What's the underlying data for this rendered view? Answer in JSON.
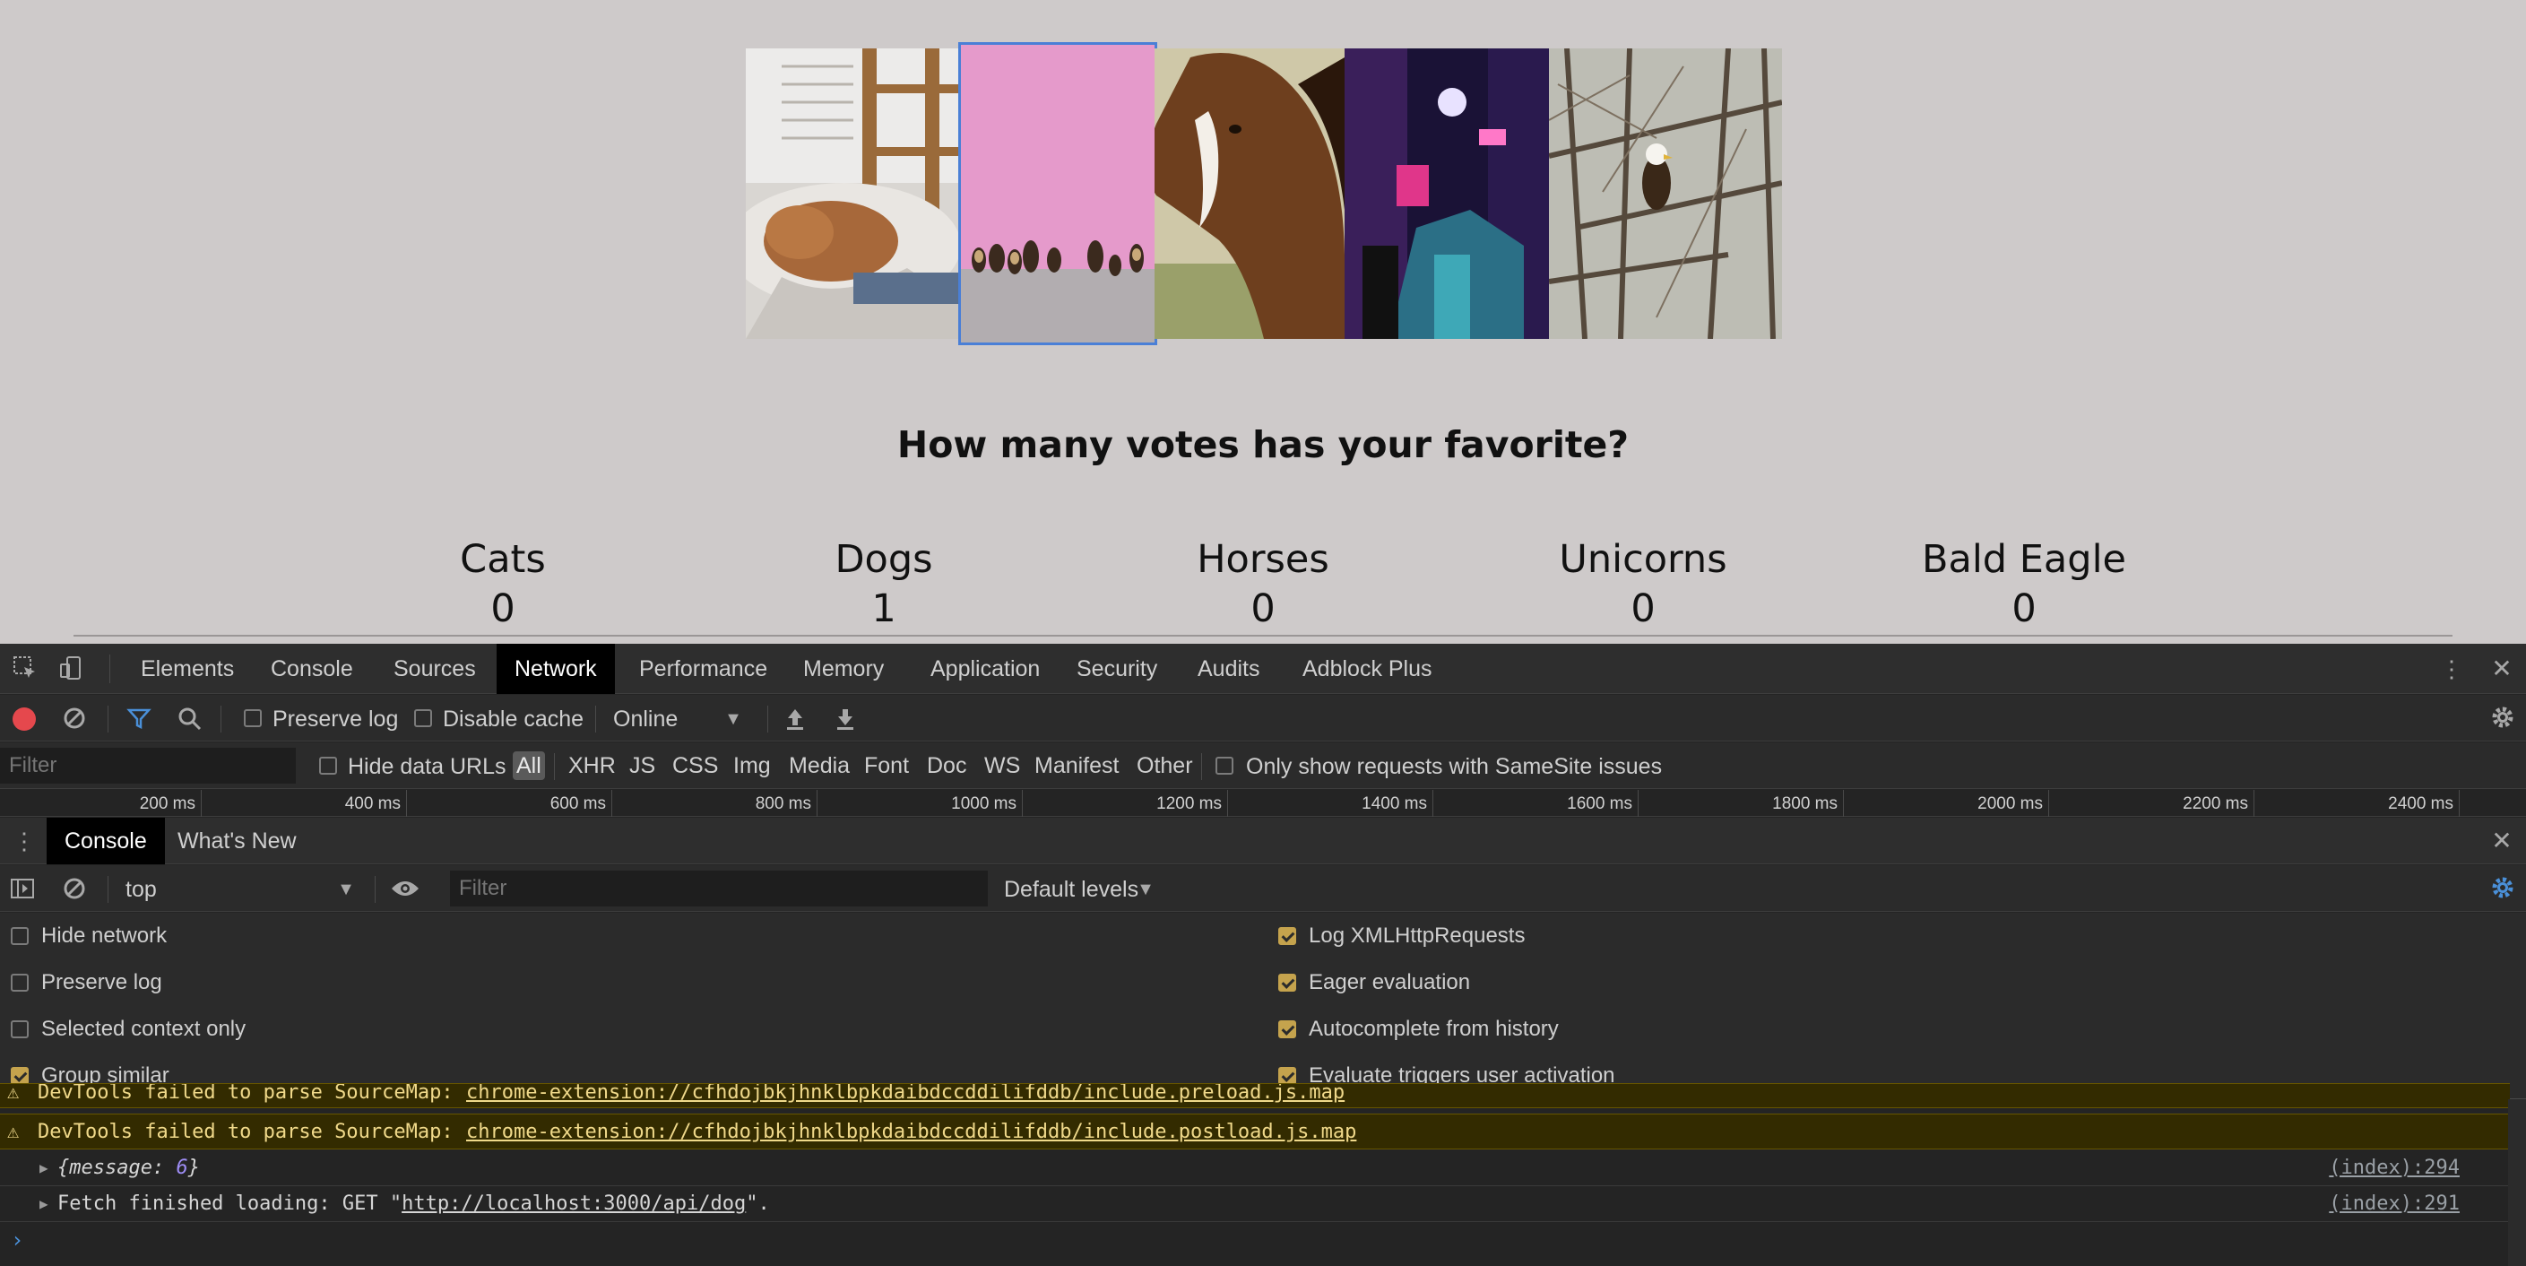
{
  "page": {
    "heading": "How many votes has your favorite?",
    "photos": [
      {
        "name": "cats-photo",
        "alt": "Cat sleeping on a blanket by a window"
      },
      {
        "name": "dogs-photo",
        "alt": "Dogs sitting in front of a pink wall"
      },
      {
        "name": "horses-photo",
        "alt": "Brown horse with white blaze"
      },
      {
        "name": "unicorns-photo",
        "alt": "Neon lit city street at night"
      },
      {
        "name": "bald-eagle-photo",
        "alt": "Bald eagle perched in bare trees"
      }
    ],
    "votes": [
      {
        "label": "Cats",
        "count": "0"
      },
      {
        "label": "Dogs",
        "count": "1"
      },
      {
        "label": "Horses",
        "count": "0"
      },
      {
        "label": "Unicorns",
        "count": "0"
      },
      {
        "label": "Bald Eagle",
        "count": "0"
      }
    ]
  },
  "devtools": {
    "tabs": [
      "Elements",
      "Console",
      "Sources",
      "Network",
      "Performance",
      "Memory",
      "Application",
      "Security",
      "Audits",
      "Adblock Plus"
    ],
    "active_tab": "Network",
    "network": {
      "preserve_log": "Preserve log",
      "disable_cache": "Disable cache",
      "throttle": "Online",
      "filter_placeholder": "Filter",
      "hide_data_urls": "Hide data URLs",
      "types": [
        "All",
        "XHR",
        "JS",
        "CSS",
        "Img",
        "Media",
        "Font",
        "Doc",
        "WS",
        "Manifest",
        "Other"
      ],
      "samesite": "Only show requests with SameSite issues",
      "timeline_ticks": [
        "200 ms",
        "400 ms",
        "600 ms",
        "800 ms",
        "1000 ms",
        "1200 ms",
        "1400 ms",
        "1600 ms",
        "1800 ms",
        "2000 ms",
        "2200 ms",
        "2400 ms"
      ]
    },
    "drawer": {
      "tabs": [
        "Console",
        "What's New"
      ],
      "context": "top",
      "filter_placeholder": "Filter",
      "levels": "Default levels",
      "settings_left": [
        {
          "label": "Hide network",
          "checked": false
        },
        {
          "label": "Preserve log",
          "checked": false
        },
        {
          "label": "Selected context only",
          "checked": false
        },
        {
          "label": "Group similar",
          "checked": true
        }
      ],
      "settings_right": [
        {
          "label": "Log XMLHttpRequests",
          "checked": true
        },
        {
          "label": "Eager evaluation",
          "checked": true
        },
        {
          "label": "Autocomplete from history",
          "checked": true
        },
        {
          "label": "Evaluate triggers user activation",
          "checked": true
        }
      ]
    },
    "log": {
      "warn_prefix": "DevTools failed to parse SourceMap: ",
      "warn1_url": "chrome-extension://cfhdojbkjhnklbpkdaibdccddilifddb/include.preload.js.map",
      "warn2_url": "chrome-extension://cfhdojbkjhnklbpkdaibdccddilifddb/include.postload.js.map",
      "obj_key": "message",
      "obj_val": "6",
      "obj_source": "(index):294",
      "fetch_prefix": "Fetch finished loading: GET \"",
      "fetch_url": "http://localhost:3000/api/dog",
      "fetch_suffix": "\".",
      "fetch_source": "(index):291"
    }
  },
  "colors": {
    "page_bg": "#cecaca",
    "selection": "#4a7fd6",
    "record": "#e5484d",
    "warning_bg": "#332b00",
    "checkbox_checked": "#c5a34d",
    "gear_blue": "#4a90d9"
  }
}
